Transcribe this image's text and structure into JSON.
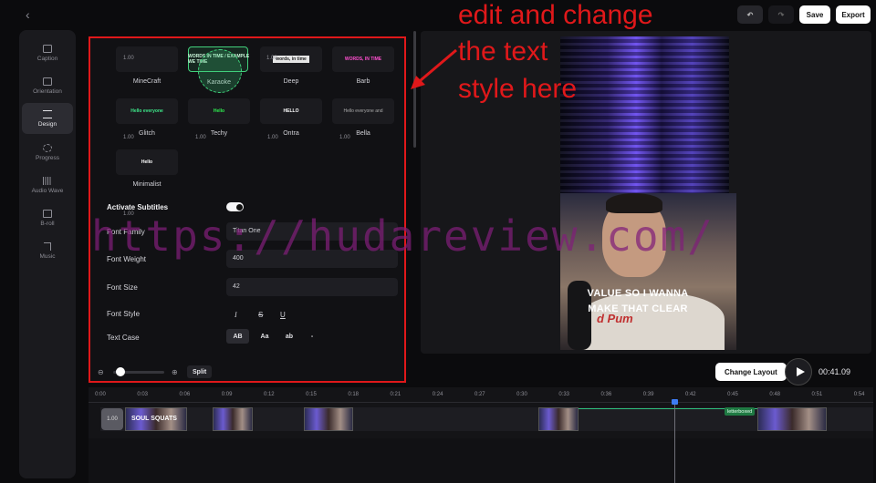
{
  "app": {
    "back_glyph": "‹",
    "undo_glyph": "↶",
    "redo_glyph": "↷",
    "save": "Save",
    "export": "Export"
  },
  "sidebar": {
    "items": [
      {
        "label": "Caption",
        "icon": "caption-icon"
      },
      {
        "label": "Orientation",
        "icon": "orientation-icon"
      },
      {
        "label": "Design",
        "icon": "design-icon",
        "active": true
      },
      {
        "label": "Progress",
        "icon": "progress-icon"
      },
      {
        "label": "Audio Wave",
        "icon": "audio-wave-icon"
      },
      {
        "label": "B-roll",
        "icon": "b-roll-icon"
      },
      {
        "label": "Music",
        "icon": "music-icon"
      }
    ]
  },
  "styles": [
    {
      "name": "MineCraft",
      "num": "1.00",
      "preview": ""
    },
    {
      "name": "Karaoke",
      "num": "",
      "preview": "WORDS IN TIME / EXAMPLE WE TIME"
    },
    {
      "name": "Deep",
      "num": "1.00",
      "preview": "words, in time"
    },
    {
      "name": "Barb",
      "num": "",
      "preview": "WORDS, IN TIME"
    },
    {
      "name": "Glitch",
      "num": "1.00",
      "preview": "Hello everyone"
    },
    {
      "name": "Techy",
      "num": "1.00",
      "preview": "Hello"
    },
    {
      "name": "Ontra",
      "num": "1.00",
      "preview": "HELLO"
    },
    {
      "name": "Bella",
      "num": "1.00",
      "preview": "Hello everyone and"
    },
    {
      "name": "Minimalist",
      "num": "1.00",
      "preview": "Hello"
    }
  ],
  "settings": {
    "activate_subtitles": "Activate Subtitles",
    "font_family_label": "Font Family",
    "font_family_value": "Titan One",
    "font_weight_label": "Font Weight",
    "font_weight_value": "400",
    "font_size_label": "Font Size",
    "font_size_value": "42",
    "font_style_label": "Font Style",
    "text_case_label": "Text Case",
    "font_style_buttons": [
      "I",
      "S",
      "U"
    ],
    "text_case_buttons": [
      "AB",
      "Aa",
      "ab",
      "-"
    ]
  },
  "zoom": {
    "minus": "⊖",
    "plus": "⊕",
    "split": "Split",
    "level": 0.05
  },
  "preview": {
    "caption_line1": "VALUE SO I WANNA",
    "caption_line2": "MAKE THAT CLEAR",
    "shirt_text": "d Pum",
    "clip_title": "SOUL SQUATS"
  },
  "controls": {
    "change_layout": "Change Layout",
    "time": "00:41.09"
  },
  "timeline": {
    "ticks": [
      "0:00",
      "0:03",
      "0:06",
      "0:09",
      "0:12",
      "0:15",
      "0:18",
      "0:21",
      "0:24",
      "0:27",
      "0:30",
      "0:33",
      "0:36",
      "0:39",
      "0:42",
      "0:45",
      "0:48",
      "0:51",
      "0:54"
    ],
    "clip_start_label": "1.00",
    "badge": "letterboxed"
  },
  "annotation": {
    "line1": "edit and change",
    "line2": "the text",
    "line3": "style here",
    "color": "#e0181a"
  },
  "watermark": "https://hudareview.com/"
}
